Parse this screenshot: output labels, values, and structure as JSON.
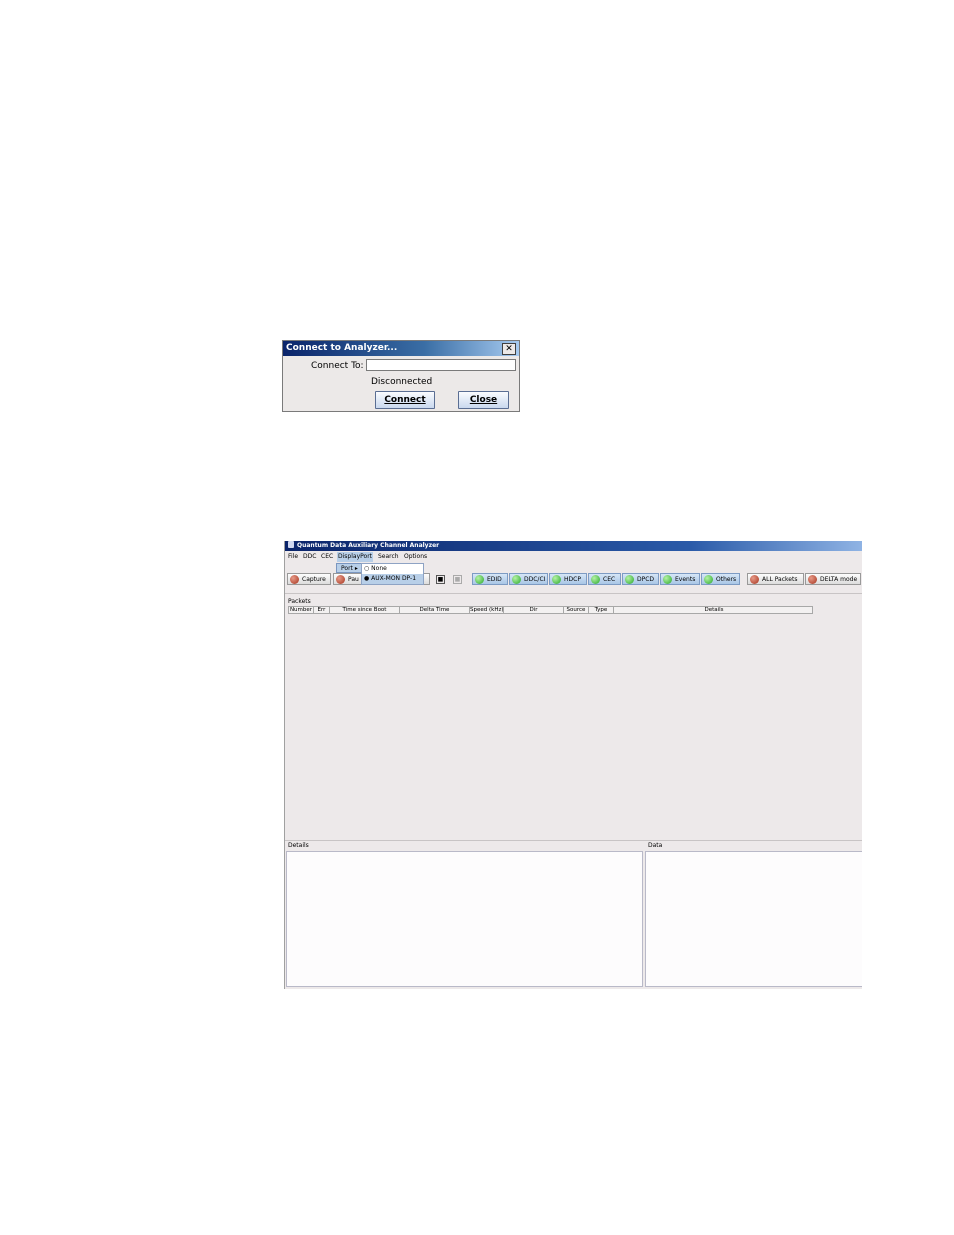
{
  "dialog": {
    "title": "Connect to Analyzer...",
    "close_glyph": "✕",
    "connect_to_label": "Connect To:",
    "connect_to_value": "",
    "status": "Disconnected",
    "connect_button": "Connect",
    "close_button": "Close"
  },
  "window": {
    "title": "Quantum Data Auxiliary Channel Analyzer",
    "menu": [
      "File",
      "DDC",
      "CEC",
      "DisplayPort",
      "Search",
      "Options"
    ],
    "active_menu": "DisplayPort",
    "dropdown": {
      "item": "Port",
      "submenu": [
        {
          "label": "None",
          "selected": false
        },
        {
          "label": "AUX-MON DP-1",
          "selected": true
        }
      ]
    },
    "toolbar": {
      "capture": "Capture",
      "pause": "Pau",
      "filters": [
        "EDID",
        "DDC/CI",
        "HDCP",
        "CEC",
        "DPCD",
        "Events",
        "Others"
      ],
      "all_packets": "ALL Packets",
      "delta_mode": "DELTA mode"
    },
    "packets_label": "Packets",
    "columns": [
      "Number",
      "Err",
      "Time since Boot",
      "Delta Time",
      "Speed (kHz)",
      "Dir",
      "Source",
      "Type",
      "Details"
    ],
    "details_label": "Details",
    "data_label": "Data"
  },
  "colors": {
    "titlebar_start": "#0a246a",
    "button_green": "#27a82b",
    "button_red": "#a5331d",
    "menu_highlight": "#b8cfe8"
  }
}
